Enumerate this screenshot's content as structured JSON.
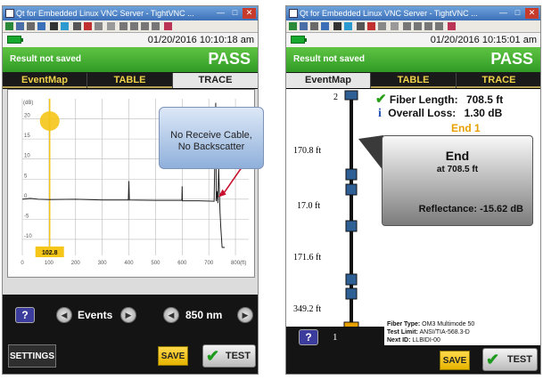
{
  "left": {
    "window_title": "Qt for Embedded Linux VNC Server - TightVNC ...",
    "datetime": "01/20/2016 10:10:18 am",
    "result_text": "Result not saved",
    "pass_text": "PASS",
    "tabs": [
      "EventMap",
      "TABLE",
      "TRACE"
    ],
    "active_tab": "TRACE",
    "callout": {
      "line1": "No Receive Cable,",
      "line2": "No Backscatter"
    },
    "cursor_value": "102.8",
    "controls": {
      "events_label": "Events",
      "wavelength_label": "850 nm"
    },
    "buttons": {
      "settings": "SETTINGS",
      "save": "SAVE",
      "test": "TEST",
      "help": "?"
    },
    "chart_data": {
      "type": "line",
      "ylabel": "(dB)",
      "xlabel": "(ft)",
      "y_ticks": [
        "20",
        "15",
        "10",
        "5",
        "0",
        "-5",
        "-10"
      ],
      "x_ticks": [
        "0",
        "100",
        "200",
        "300",
        "400",
        "500",
        "600",
        "700",
        "800"
      ],
      "xlim": [
        0,
        850
      ],
      "ylim": [
        -14,
        25
      ],
      "grid": true,
      "cursor_x": 102.8,
      "series": [
        {
          "x": [
            0,
            30,
            60,
            100,
            200,
            300,
            398,
            400,
            402,
            500,
            560,
            599,
            600,
            601,
            660,
            720,
            726,
            728,
            732,
            734,
            737,
            742,
            745,
            750,
            760
          ],
          "y": [
            0,
            0.2,
            0,
            -0.1,
            0,
            -0.2,
            -0.2,
            4.5,
            -0.2,
            -0.3,
            -0.3,
            -0.3,
            3.2,
            -0.4,
            -0.4,
            -0.5,
            24,
            -0.5,
            2,
            -1,
            8,
            -3,
            -7,
            -12,
            -12
          ]
        }
      ]
    }
  },
  "right": {
    "window_title": "Qt for Embedded Linux VNC Server - TightVNC ...",
    "datetime": "01/20/2016 10:15:01 am",
    "result_text": "Result not saved",
    "pass_text": "PASS",
    "tabs": [
      "EventMap",
      "TABLE",
      "TRACE"
    ],
    "active_tab": "EventMap",
    "fiber_length_label": "Fiber Length:",
    "fiber_length_value": "708.5 ft",
    "overall_loss_label": "Overall Loss:",
    "overall_loss_value": "1.30 dB",
    "end_label": "End 1",
    "event_panel": {
      "title": "End",
      "subtitle": "at 708.5 ft",
      "reflectance": "Reflectance: -15.62 dB"
    },
    "map_labels": {
      "top_num": "2",
      "d1": "170.8 ft",
      "d2": "17.0 ft",
      "d3": "171.6 ft",
      "d4": "349.2 ft",
      "bottom_num": "1"
    },
    "fiber_type_label": "Fiber Type:",
    "fiber_type_value": "OM3 Multimode 50",
    "test_limit_label": "Test Limit:",
    "test_limit_value": "ANSI/TIA-568.3-D",
    "next_id_label": "Next ID:",
    "next_id_value": "LLBIDI-00",
    "buttons": {
      "save": "SAVE",
      "test": "TEST",
      "help": "?"
    },
    "colors": {
      "connector_blue": "#2e5f95",
      "check_green": "#27a018",
      "end_orange": "#e8a000",
      "info_blue": "#2b58b6"
    }
  },
  "colors": {
    "pass_green": "#3bab2b",
    "tab_yellow": "#f0d24a",
    "trace_red": "#c8102e",
    "cursor_yellow": "#f5c518"
  }
}
